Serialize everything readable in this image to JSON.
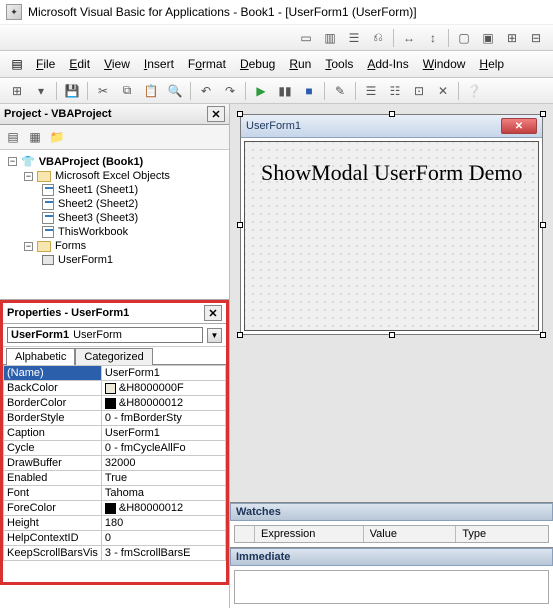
{
  "window_title": "Microsoft Visual Basic for Applications - Book1 - [UserForm1 (UserForm)]",
  "menus": {
    "file": "File",
    "edit": "Edit",
    "view": "View",
    "insert": "Insert",
    "format": "Format",
    "debug": "Debug",
    "run": "Run",
    "tools": "Tools",
    "addins": "Add-Ins",
    "window": "Window",
    "help": "Help"
  },
  "project": {
    "pane_title": "Project - VBAProject",
    "root": "VBAProject (Book1)",
    "group_excel": "Microsoft Excel Objects",
    "sheet1": "Sheet1 (Sheet1)",
    "sheet2": "Sheet2 (Sheet2)",
    "sheet3": "Sheet3 (Sheet3)",
    "thisworkbook": "ThisWorkbook",
    "group_forms": "Forms",
    "userform1": "UserForm1"
  },
  "properties": {
    "pane_title": "Properties - UserForm1",
    "object_name": "UserForm1",
    "object_type": "UserForm",
    "tab_alpha": "Alphabetic",
    "tab_cat": "Categorized",
    "rows": [
      {
        "name": "(Name)",
        "value": "UserForm1",
        "selected": true
      },
      {
        "name": "BackColor",
        "value": "&H8000000F",
        "swatch": "#ece9d8"
      },
      {
        "name": "BorderColor",
        "value": "&H80000012",
        "swatch": "#000000"
      },
      {
        "name": "BorderStyle",
        "value": "0 - fmBorderSty"
      },
      {
        "name": "Caption",
        "value": "UserForm1"
      },
      {
        "name": "Cycle",
        "value": "0 - fmCycleAllFo"
      },
      {
        "name": "DrawBuffer",
        "value": "32000"
      },
      {
        "name": "Enabled",
        "value": "True"
      },
      {
        "name": "Font",
        "value": "Tahoma"
      },
      {
        "name": "ForeColor",
        "value": "&H80000012",
        "swatch": "#000000"
      },
      {
        "name": "Height",
        "value": "180"
      },
      {
        "name": "HelpContextID",
        "value": "0"
      },
      {
        "name": "KeepScrollBarsVis",
        "value": "3 - fmScrollBarsE"
      }
    ]
  },
  "designer": {
    "form_caption": "UserForm1",
    "label_text": "ShowModal UserForm Demo"
  },
  "watches": {
    "title": "Watches",
    "col_expression": "Expression",
    "col_value": "Value",
    "col_type": "Type"
  },
  "immediate": {
    "title": "Immediate"
  }
}
